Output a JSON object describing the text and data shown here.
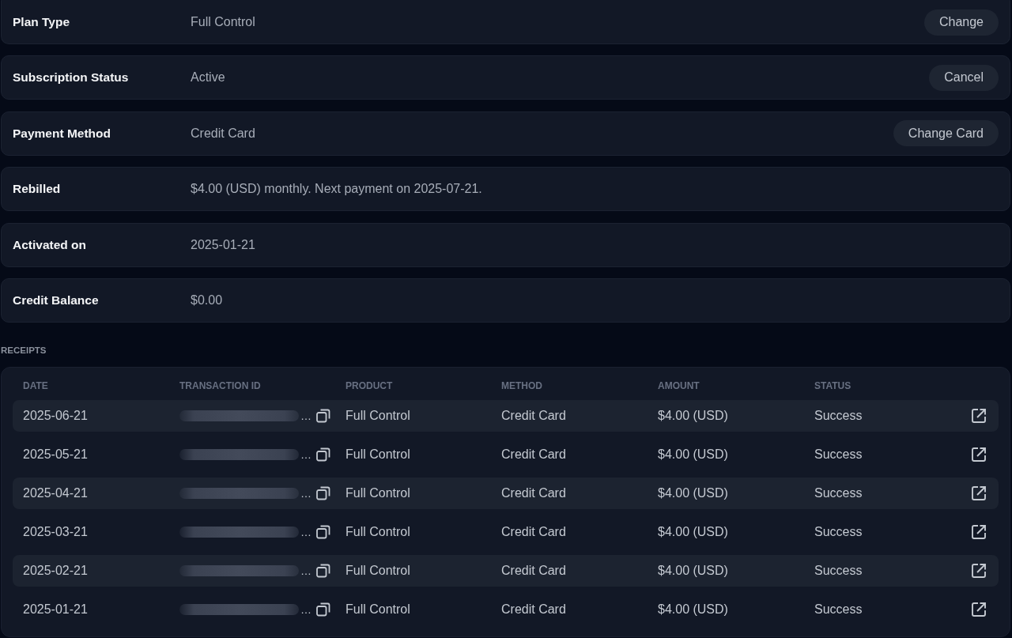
{
  "details": [
    {
      "label": "Plan Type",
      "value": "Full Control",
      "action": "Change"
    },
    {
      "label": "Subscription Status",
      "value": "Active",
      "action": "Cancel"
    },
    {
      "label": "Payment Method",
      "value": "Credit Card",
      "action": "Change Card"
    },
    {
      "label": "Rebilled",
      "value": "$4.00 (USD) monthly. Next payment on 2025-07-21."
    },
    {
      "label": "Activated on",
      "value": "2025-01-21"
    },
    {
      "label": "Credit Balance",
      "value": "$0.00"
    }
  ],
  "receipts": {
    "title": "RECEIPTS",
    "columns": [
      "DATE",
      "TRANSACTION ID",
      "PRODUCT",
      "METHOD",
      "AMOUNT",
      "STATUS"
    ],
    "rows": [
      {
        "date": "2025-06-21",
        "transaction_id": "…",
        "product": "Full Control",
        "method": "Credit Card",
        "amount": "$4.00 (USD)",
        "status": "Success"
      },
      {
        "date": "2025-05-21",
        "transaction_id": "…",
        "product": "Full Control",
        "method": "Credit Card",
        "amount": "$4.00 (USD)",
        "status": "Success"
      },
      {
        "date": "2025-04-21",
        "transaction_id": "…",
        "product": "Full Control",
        "method": "Credit Card",
        "amount": "$4.00 (USD)",
        "status": "Success"
      },
      {
        "date": "2025-03-21",
        "transaction_id": "…",
        "product": "Full Control",
        "method": "Credit Card",
        "amount": "$4.00 (USD)",
        "status": "Success"
      },
      {
        "date": "2025-02-21",
        "transaction_id": "…",
        "product": "Full Control",
        "method": "Credit Card",
        "amount": "$4.00 (USD)",
        "status": "Success"
      },
      {
        "date": "2025-01-21",
        "transaction_id": "…",
        "product": "Full Control",
        "method": "Credit Card",
        "amount": "$4.00 (USD)",
        "status": "Success"
      }
    ]
  }
}
